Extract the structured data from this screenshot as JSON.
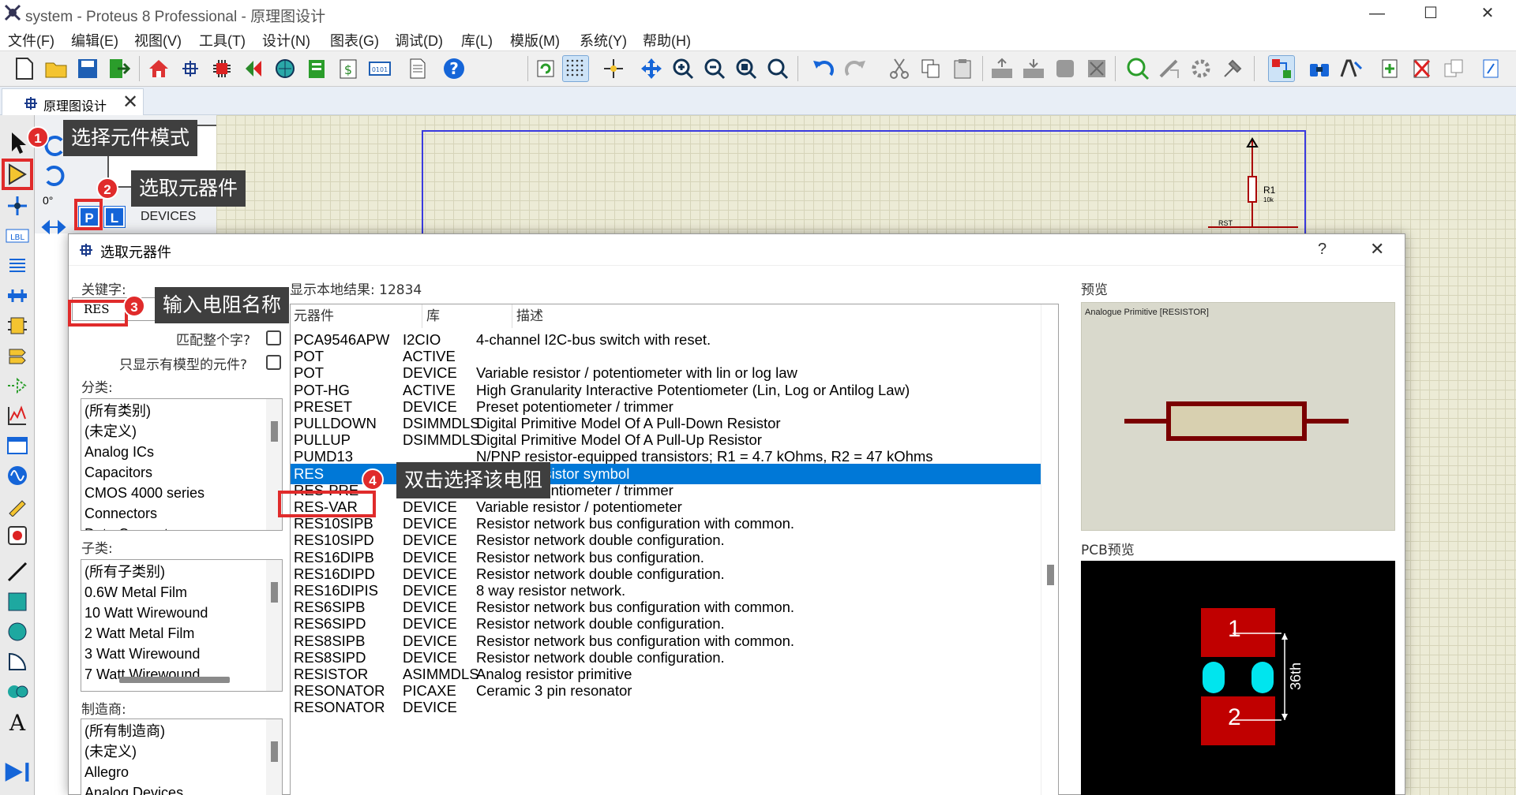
{
  "window": {
    "title": "system - Proteus 8 Professional - 原理图设计",
    "minimize": "—",
    "maximize": "☐",
    "close": "✕"
  },
  "menu": [
    "文件(F)",
    "编辑(E)",
    "视图(V)",
    "工具(T)",
    "设计(N)",
    "图表(G)",
    "调试(D)",
    "库(L)",
    "模版(M)",
    "系统(Y)",
    "帮助(H)"
  ],
  "tab": {
    "label": "原理图设计",
    "close": "✕"
  },
  "left_panel": {
    "angle": "0°",
    "p_button": "P",
    "l_button": "L",
    "devices_label": "DEVICES"
  },
  "schematic": {
    "resistor_ref": "R1",
    "resistor_val": "10k",
    "net_label": "RST"
  },
  "callouts": [
    {
      "num": "1",
      "text": "选择元件模式"
    },
    {
      "num": "2",
      "text": "选取元器件"
    },
    {
      "num": "3",
      "text": "输入电阻名称"
    },
    {
      "num": "4",
      "text": "双击选择该电阻"
    }
  ],
  "dialog": {
    "title": "选取元器件",
    "help": "?",
    "close": "✕",
    "keyword_label": "关键字:",
    "keyword_value": "RES",
    "match_whole": "匹配整个字?",
    "only_models": "只显示有模型的元件?",
    "category_label": "分类:",
    "categories": [
      "(所有类别)",
      "(未定义)",
      "Analog ICs",
      "Capacitors",
      "CMOS 4000 series",
      "Connectors",
      "Data Converters"
    ],
    "subcategory_label": "子类:",
    "subcategories": [
      "(所有子类别)",
      "0.6W Metal Film",
      "10 Watt Wirewound",
      "2 Watt Metal Film",
      "3 Watt Wirewound",
      "7 Watt Wirewound"
    ],
    "manufacturer_label": "制造商:",
    "manufacturers": [
      "(所有制造商)",
      "(未定义)",
      "Allegro",
      "Analog Devices"
    ],
    "results_label": "显示本地结果: 12834",
    "col_device": "元器件",
    "col_library": "库",
    "col_desc": "描述",
    "rows": [
      {
        "device": "PCA9546APW",
        "library": "I2CIO",
        "desc": "4-channel I2C-bus switch with reset."
      },
      {
        "device": "POT",
        "library": "ACTIVE",
        "desc": ""
      },
      {
        "device": "POT",
        "library": "DEVICE",
        "desc": "Variable resistor / potentiometer with lin or log law"
      },
      {
        "device": "POT-HG",
        "library": "ACTIVE",
        "desc": "High Granularity Interactive Potentiometer (Lin, Log or Antilog Law)"
      },
      {
        "device": "PRESET",
        "library": "DEVICE",
        "desc": "Preset potentiometer / trimmer"
      },
      {
        "device": "PULLDOWN",
        "library": "DSIMMDLS",
        "desc": "Digital Primitive Model Of A Pull-Down Resistor"
      },
      {
        "device": "PULLUP",
        "library": "DSIMMDLS",
        "desc": "Digital Primitive Model Of A Pull-Up Resistor"
      },
      {
        "device": "PUMD13",
        "library": "",
        "desc": "N/PNP resistor-equipped transistors; R1 = 4.7 kOhms, R2 = 47 kOhms"
      },
      {
        "device": "RES",
        "library": "DEVICE",
        "desc": "Generic resistor symbol"
      },
      {
        "device": "RES-PRE",
        "library": "DEVICE",
        "desc": "Preset potentiometer / trimmer"
      },
      {
        "device": "RES-VAR",
        "library": "DEVICE",
        "desc": "Variable resistor / potentiometer"
      },
      {
        "device": "RES10SIPB",
        "library": "DEVICE",
        "desc": "Resistor network bus configuration with common."
      },
      {
        "device": "RES10SIPD",
        "library": "DEVICE",
        "desc": "Resistor network double configuration."
      },
      {
        "device": "RES16DIPB",
        "library": "DEVICE",
        "desc": "Resistor network bus configuration."
      },
      {
        "device": "RES16DIPD",
        "library": "DEVICE",
        "desc": "Resistor network double configuration."
      },
      {
        "device": "RES16DIPIS",
        "library": "DEVICE",
        "desc": "8 way resistor network."
      },
      {
        "device": "RES6SIPB",
        "library": "DEVICE",
        "desc": "Resistor network bus configuration with common."
      },
      {
        "device": "RES6SIPD",
        "library": "DEVICE",
        "desc": "Resistor network double configuration."
      },
      {
        "device": "RES8SIPB",
        "library": "DEVICE",
        "desc": "Resistor network bus configuration with common."
      },
      {
        "device": "RES8SIPD",
        "library": "DEVICE",
        "desc": "Resistor network double configuration."
      },
      {
        "device": "RESISTOR",
        "library": "ASIMMDLS",
        "desc": "Analog resistor primitive"
      },
      {
        "device": "RESONATOR",
        "library": "PICAXE",
        "desc": "Ceramic 3 pin resonator"
      },
      {
        "device": "RESONATOR",
        "library": "DEVICE",
        "desc": ""
      }
    ],
    "selected_row": 8,
    "preview_label": "预览",
    "preview_caption": "Analogue Primitive [RESISTOR]",
    "pcb_label": "PCB预览",
    "pad1": "1",
    "pad2": "2",
    "pcb_dim": "36th"
  },
  "colors": {
    "accent": "#0078d7",
    "callout_red": "#e02b2b",
    "resistor": "#7a0000",
    "pcb_pad": "#c00000",
    "pcb_via": "#00e5ee"
  }
}
